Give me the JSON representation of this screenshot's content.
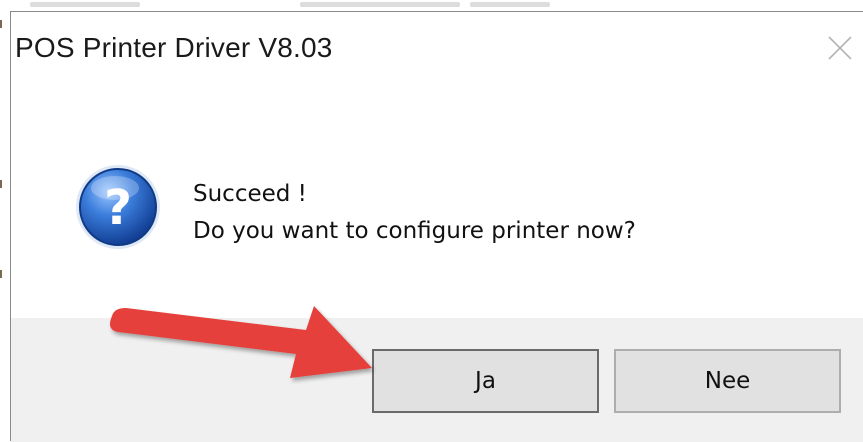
{
  "dialog": {
    "title": "POS Printer Driver V8.03",
    "icon": "question-icon",
    "message_line1": "Succeed !",
    "message_line2": "Do you want to configure printer now?",
    "yes_label": "Ja",
    "no_label": "Nee",
    "close_icon": "close-icon"
  },
  "annotation": {
    "arrow_color": "#e5403a",
    "arrow_icon": "red-arrow-annotation"
  },
  "colors": {
    "footer_bg": "#f0f0f0",
    "icon_blue": "#1f5fbf"
  }
}
